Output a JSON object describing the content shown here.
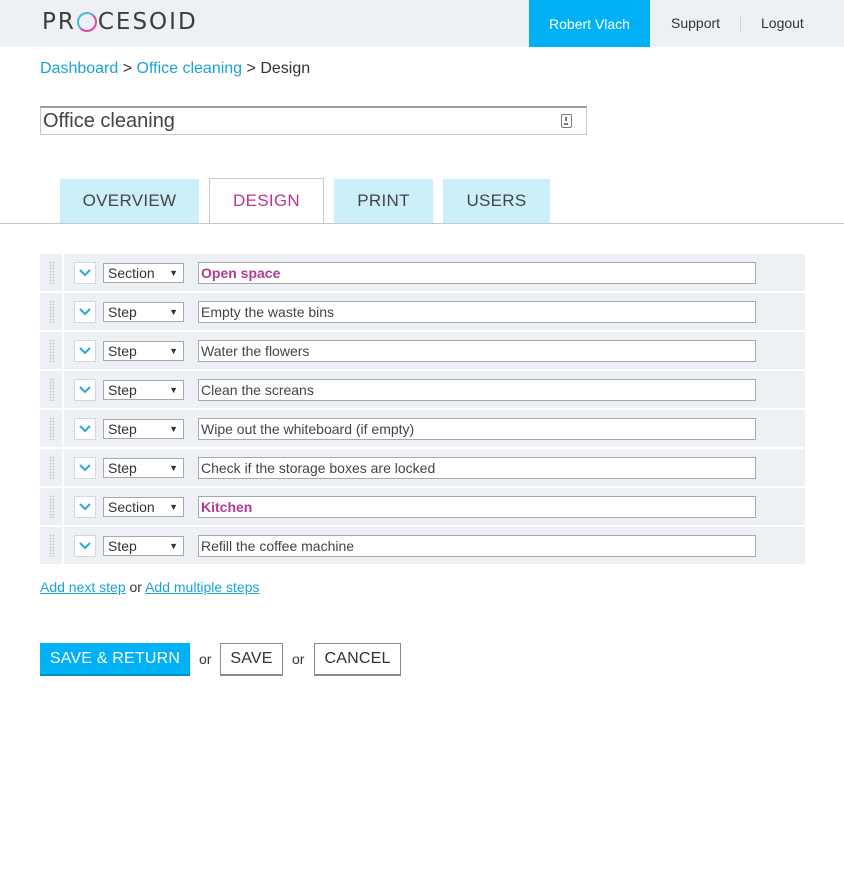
{
  "header": {
    "logo_left": "PR",
    "logo_right": "CESOID",
    "user_name": "Robert Vlach",
    "support_label": "Support",
    "logout_label": "Logout"
  },
  "breadcrumb": {
    "items": [
      "Dashboard",
      "Office cleaning",
      "Design"
    ],
    "separator": ">"
  },
  "title": {
    "value": "Office cleaning"
  },
  "tabs": [
    {
      "label": "OVERVIEW",
      "active": false
    },
    {
      "label": "DESIGN",
      "active": true
    },
    {
      "label": "PRINT",
      "active": false
    },
    {
      "label": "USERS",
      "active": false
    }
  ],
  "steps": [
    {
      "type": "Section",
      "text": "Open space"
    },
    {
      "type": "Step",
      "text": "Empty the waste bins"
    },
    {
      "type": "Step",
      "text": "Water the flowers"
    },
    {
      "type": "Step",
      "text": "Clean the screans"
    },
    {
      "type": "Step",
      "text": "Wipe out the whiteboard (if empty)"
    },
    {
      "type": "Step",
      "text": "Check if the storage boxes are locked"
    },
    {
      "type": "Section",
      "text": "Kitchen"
    },
    {
      "type": "Step",
      "text": "Refill the coffee machine"
    }
  ],
  "add_links": {
    "next": "Add next step",
    "or": "or",
    "multiple": "Add multiple steps"
  },
  "actions": {
    "save_return": "SAVE & RETURN",
    "or": "or",
    "save": "SAVE",
    "cancel": "CANCEL"
  },
  "colors": {
    "accent": "#00b2f5",
    "tab_inactive": "#cdeffb",
    "tab_active_text": "#c0338d",
    "section_text": "#b13a92",
    "link": "#1aa3d9",
    "row_bg": "#edf0f5"
  }
}
